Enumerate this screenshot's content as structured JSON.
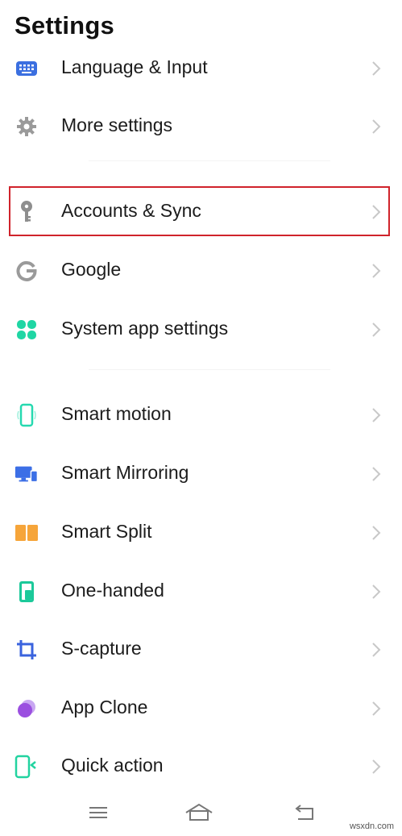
{
  "header": {
    "title": "Settings"
  },
  "colors": {
    "highlight_border": "#d0232b",
    "chevron": "#c8c8c8"
  },
  "settings_items": [
    {
      "key": "language",
      "label": "Language & Input",
      "icon": "keyboard-icon",
      "icon_color": "#3b6fe0"
    },
    {
      "key": "more",
      "label": "More settings",
      "icon": "gear-icon",
      "icon_color": "#9a9a9a"
    },
    {
      "key": "accounts",
      "label": "Accounts & Sync",
      "icon": "key-icon",
      "icon_color": "#8e8e8e",
      "highlighted": true
    },
    {
      "key": "google",
      "label": "Google",
      "icon": "google-g-icon",
      "icon_color": "#9a9a9a"
    },
    {
      "key": "system-app",
      "label": "System app settings",
      "icon": "clover-icon",
      "icon_color": "#1fd6a4"
    },
    {
      "key": "smart-motion",
      "label": "Smart motion",
      "icon": "phone-outline-icon",
      "icon_color": "#26d9b0"
    },
    {
      "key": "smart-mirroring",
      "label": "Smart Mirroring",
      "icon": "monitor-phone-icon",
      "icon_color": "#3c6fe6"
    },
    {
      "key": "smart-split",
      "label": "Smart Split",
      "icon": "split-screen-icon",
      "icon_color": "#f6a53a"
    },
    {
      "key": "one-handed",
      "label": "One-handed",
      "icon": "one-handed-phone-icon",
      "icon_color": "#1cc99a"
    },
    {
      "key": "s-capture",
      "label": "S-capture",
      "icon": "crop-icon",
      "icon_color": "#3a63de"
    },
    {
      "key": "app-clone",
      "label": "App Clone",
      "icon": "app-clone-icon",
      "icon_color": "#9b4fe0"
    },
    {
      "key": "quick-action",
      "label": "Quick action",
      "icon": "quick-action-phone-icon",
      "icon_color": "#22d3a0"
    }
  ],
  "navigation_bar": {
    "menu": "menu-icon",
    "home": "home-icon",
    "back": "back-icon"
  },
  "watermark": "wsxdn.com"
}
